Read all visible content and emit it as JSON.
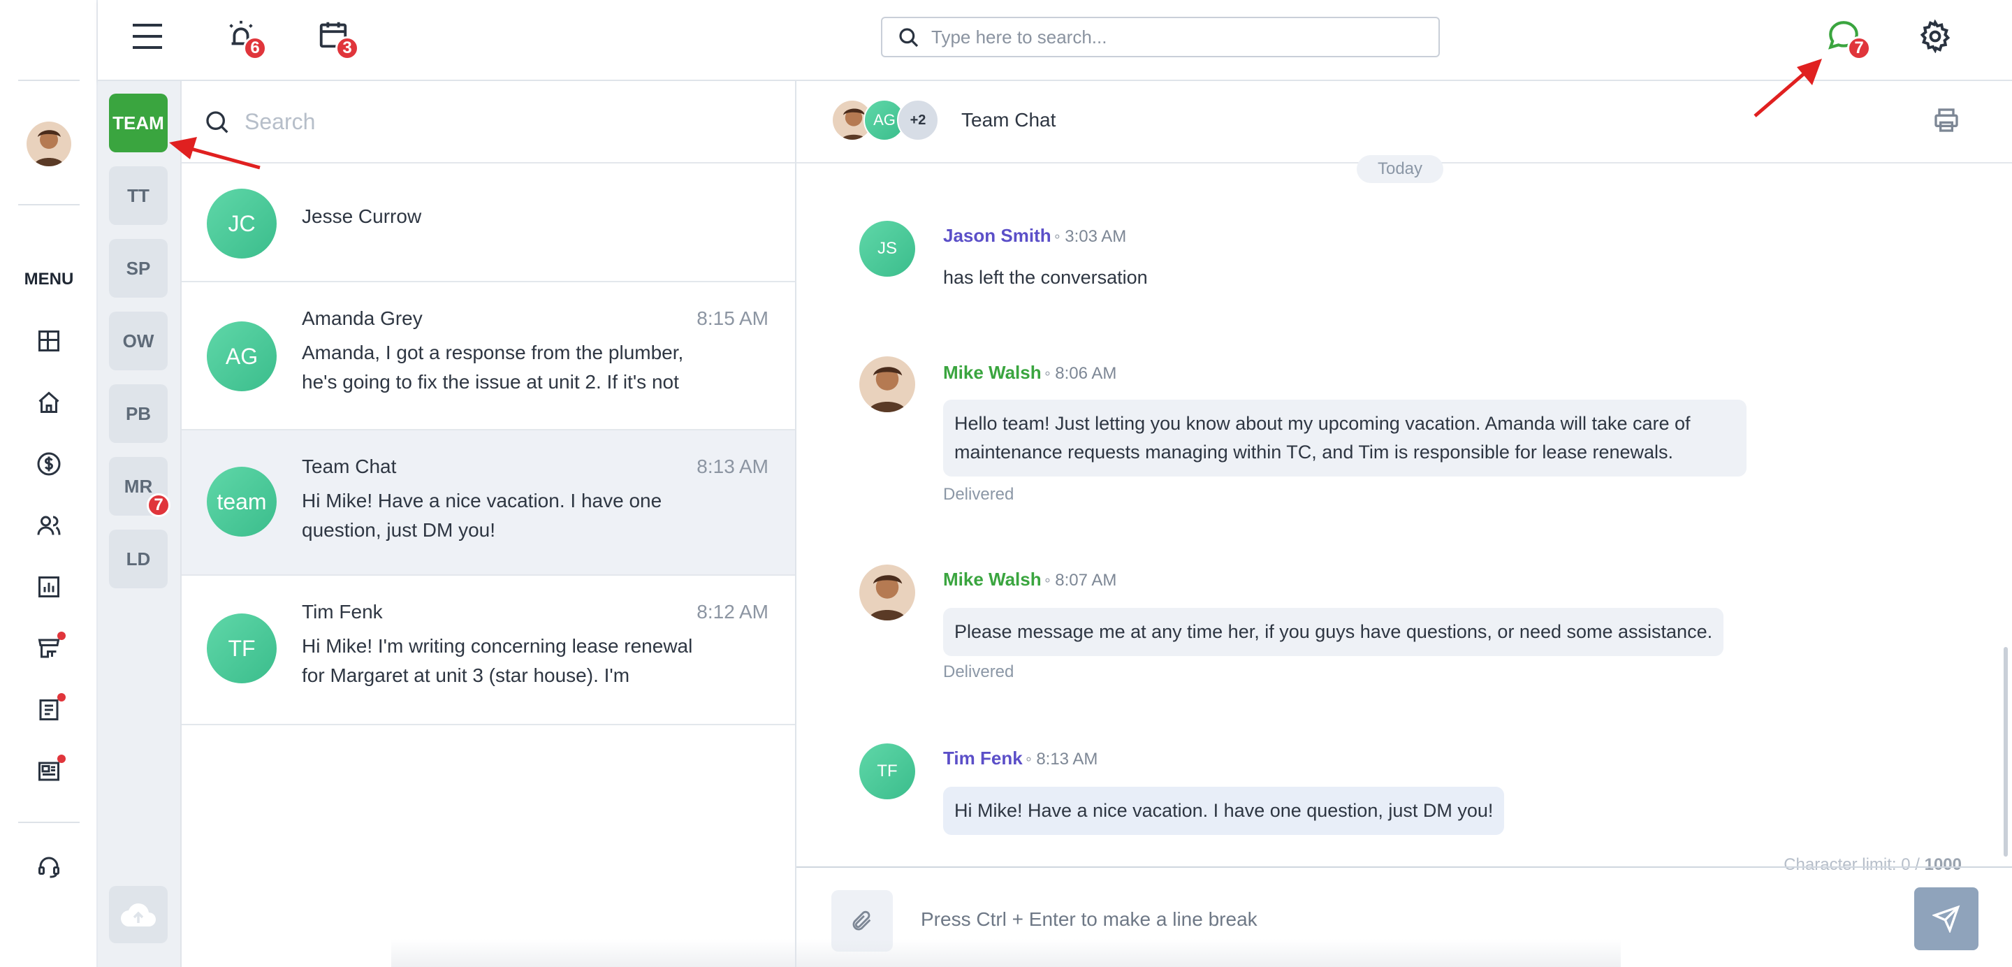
{
  "left_rail": {
    "menu_label": "MENU",
    "nav_icons": [
      "dashboard-icon",
      "home-icon",
      "dollar-icon",
      "people-icon",
      "chart-icon",
      "shop-icon",
      "document-icon",
      "newspaper-icon"
    ],
    "support_icon": "headset-icon"
  },
  "topbar": {
    "alarm_badge": "6",
    "calendar_badge": "3",
    "search_placeholder": "Type here to search...",
    "chat_badge": "7"
  },
  "tags": {
    "items": [
      {
        "label": "TEAM",
        "active": true
      },
      {
        "label": "TT"
      },
      {
        "label": "SP"
      },
      {
        "label": "OW"
      },
      {
        "label": "PB"
      },
      {
        "label": "MR",
        "badge": "7"
      },
      {
        "label": "LD"
      }
    ]
  },
  "conversations": {
    "search_placeholder": "Search",
    "items": [
      {
        "initials": "JC",
        "name": "Jesse Currow",
        "time": "",
        "preview": ""
      },
      {
        "initials": "AG",
        "name": "Amanda Grey",
        "time": "8:15 AM",
        "preview": "Amanda, I got a response from the plumber, he's going to fix the issue at unit 2. If it's not"
      },
      {
        "initials": "team",
        "name": "Team Chat",
        "time": "8:13 AM",
        "preview": "Hi Mike! Have a nice vacation. I have one question, just DM you!"
      },
      {
        "initials": "TF",
        "name": "Tim Fenk",
        "time": "8:12 AM",
        "preview": "Hi Mike! I'm writing concerning lease renewal for Margaret at unit 3 (star house). I'm"
      }
    ]
  },
  "chat": {
    "header_avatar_initials": "AG",
    "header_more": "+2",
    "title": "Team Chat",
    "date_label": "Today",
    "messages": [
      {
        "initials": "JS",
        "author": "Jason Smith",
        "time": "3:03 AM",
        "text": "has left the conversation",
        "color": "#5b4fc8"
      },
      {
        "author": "Mike Walsh",
        "time": "8:06 AM",
        "text": "Hello team! Just letting you know about my upcoming vacation. Amanda will take care of maintenance requests managing within TC, and Tim is responsible for lease renewals.",
        "status": "Delivered",
        "color": "#3aa53f"
      },
      {
        "author": "Mike Walsh",
        "time": "8:07 AM",
        "text": "Please message me at any time her, if you guys have questions, or need some assistance.",
        "status": "Delivered",
        "color": "#3aa53f"
      },
      {
        "initials": "TF",
        "author": "Tim Fenk",
        "time": "8:13 AM",
        "text": "Hi Mike! Have a nice vacation. I have one question, just DM you!",
        "color": "#5b4fc8"
      }
    ],
    "char_limit_label": "Character limit: 0 / ",
    "char_limit_max": "1000",
    "composer_placeholder": "Press Ctrl + Enter to make a line break"
  },
  "colors": {
    "accent_green": "#3aa53f",
    "badge_red": "#e0353b",
    "author_purple": "#5b4fc8",
    "avatar_teal": "#4fcb9b"
  }
}
